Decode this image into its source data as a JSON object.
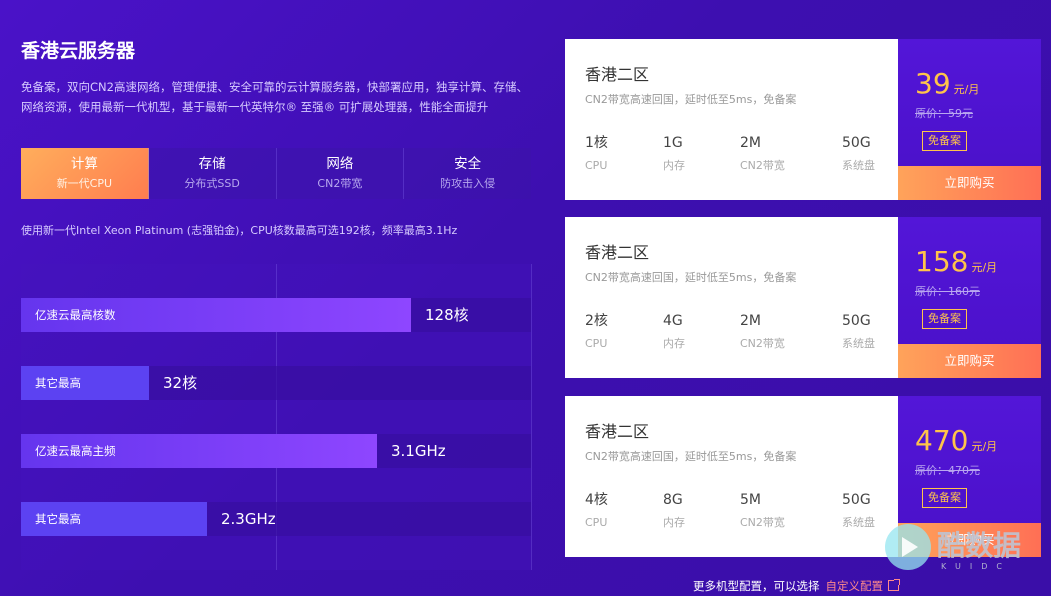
{
  "page": {
    "title": "香港云服务器",
    "description": "免备案，双向CN2高速网络，管理便捷、安全可靠的云计算服务器，快部署应用，独享计算、存储、网络资源，使用最新一代机型，基于最新一代英特尔® 至强® 可扩展处理器，性能全面提升"
  },
  "tabs": [
    {
      "label": "计算",
      "sub": "新一代CPU",
      "active": true
    },
    {
      "label": "存储",
      "sub": "分布式SSD",
      "active": false
    },
    {
      "label": "网络",
      "sub": "CN2带宽",
      "active": false
    },
    {
      "label": "安全",
      "sub": "防攻击入侵",
      "active": false
    }
  ],
  "tab_description": "使用新一代Intel Xeon Platinum (志强铂金)，CPU核数最高可选192核，频率最高3.1Hz",
  "comparison": [
    {
      "label": "亿速云最高核数",
      "value": "128核",
      "fraction": 0.765,
      "highlight": true
    },
    {
      "label": "其它最高",
      "value": "32核",
      "fraction": 0.25,
      "highlight": false
    },
    {
      "label": "亿速云最高主频",
      "value": "3.1GHz",
      "fraction": 0.698,
      "highlight": true
    },
    {
      "label": "其它最高",
      "value": "2.3GHz",
      "fraction": 0.365,
      "highlight": false
    }
  ],
  "plans": [
    {
      "name": "香港二区",
      "subtitle": "CN2带宽高速回国，延时低至5ms，免备案",
      "specs": [
        {
          "value": "1核",
          "key": "CPU"
        },
        {
          "value": "1G",
          "key": "内存"
        },
        {
          "value": "2M",
          "key": "CN2带宽"
        },
        {
          "value": "50G",
          "key": "系统盘"
        }
      ],
      "price": "39",
      "unit": "元/月",
      "original": "原价：59元",
      "badge": "免备案",
      "buy_label": "立即购买"
    },
    {
      "name": "香港二区",
      "subtitle": "CN2带宽高速回国，延时低至5ms，免备案",
      "specs": [
        {
          "value": "2核",
          "key": "CPU"
        },
        {
          "value": "4G",
          "key": "内存"
        },
        {
          "value": "2M",
          "key": "CN2带宽"
        },
        {
          "value": "50G",
          "key": "系统盘"
        }
      ],
      "price": "158",
      "unit": "元/月",
      "original": "原价：160元",
      "badge": "免备案",
      "buy_label": "立即购买"
    },
    {
      "name": "香港二区",
      "subtitle": "CN2带宽高速回国，延时低至5ms，免备案",
      "specs": [
        {
          "value": "4核",
          "key": "CPU"
        },
        {
          "value": "8G",
          "key": "内存"
        },
        {
          "value": "5M",
          "key": "CN2带宽"
        },
        {
          "value": "50G",
          "key": "系统盘"
        }
      ],
      "price": "470",
      "unit": "元/月",
      "original": "原价：470元",
      "badge": "免备案",
      "buy_label": "立即购买"
    }
  ],
  "footer": {
    "text": "更多机型配置，可以选择",
    "link": "自定义配置",
    "link_icon": "external-link-icon"
  },
  "watermark": {
    "text": "酷数据",
    "sub": "KUIDC",
    "icon": "play-icon"
  }
}
